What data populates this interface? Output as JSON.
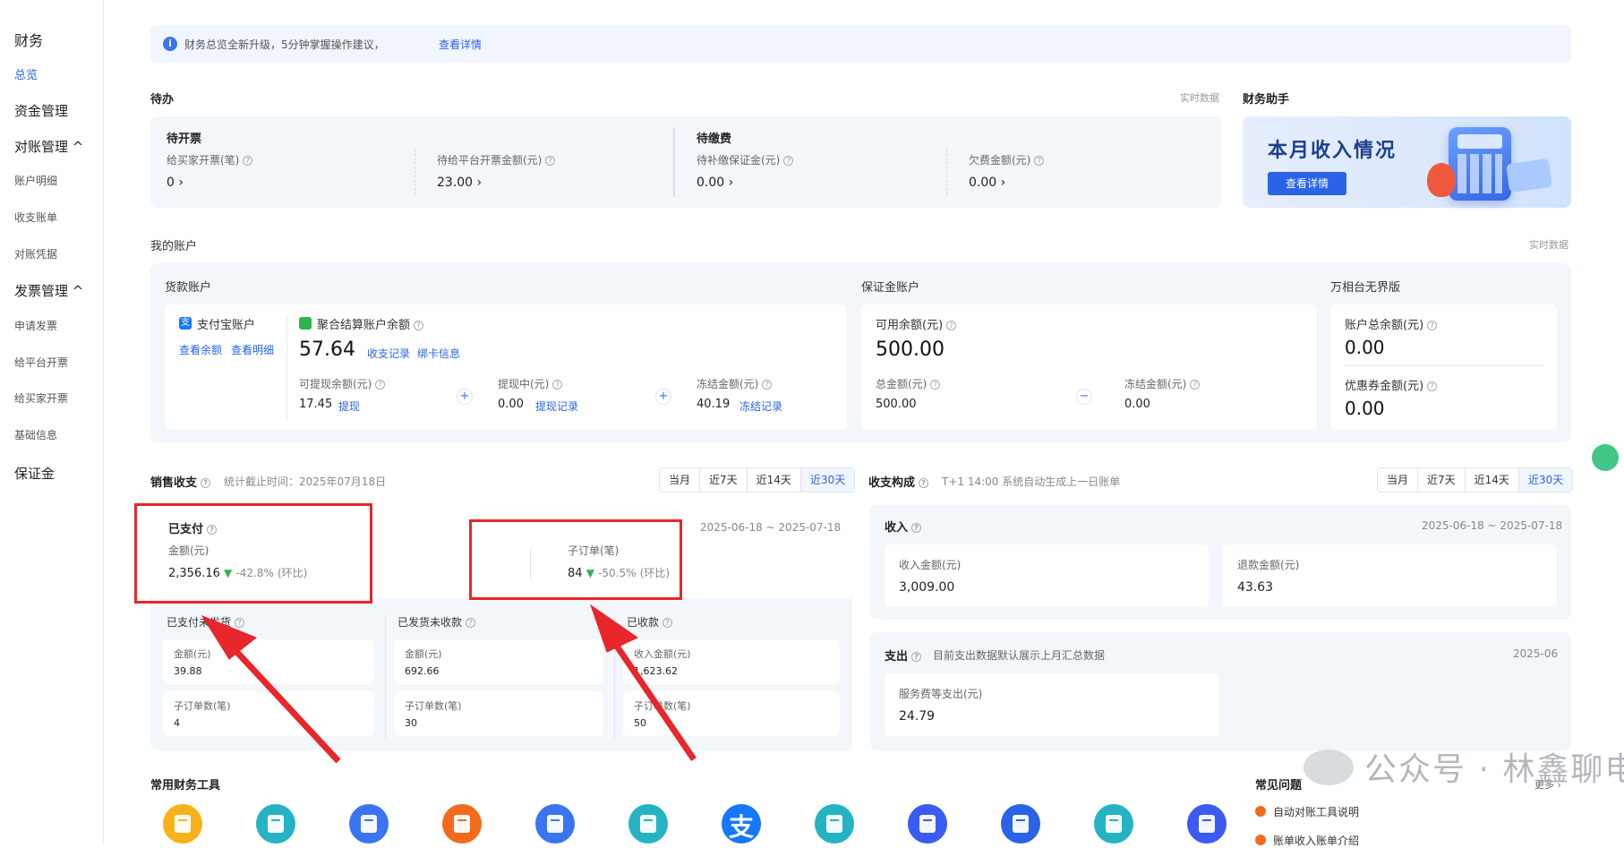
{
  "sidebar": {
    "title": "财务",
    "items": [
      {
        "label": "总览"
      },
      {
        "label": "资金管理"
      },
      {
        "label": "对账管理 ^"
      },
      {
        "label": "账户明细"
      },
      {
        "label": "收支账单"
      },
      {
        "label": "对账凭据"
      },
      {
        "label": "发票管理 ^"
      },
      {
        "label": "申请发票"
      },
      {
        "label": "给平台开票"
      },
      {
        "label": "给买家开票"
      },
      {
        "label": "基础信息"
      },
      {
        "label": "保证金"
      }
    ]
  },
  "notice": {
    "icon": "info-icon",
    "text": "财务总览全新升级，5分钟掌握操作建议，",
    "link": "查看详情"
  },
  "todo": {
    "title": "待办",
    "realtime": "实时数据",
    "invoice": {
      "title": "待开票",
      "buyer_label": "给买家开票(笔)",
      "buyer_value": "0 ›",
      "platform_label": "待给平台开票金额(元)",
      "platform_value": "23.00 ›"
    },
    "fees": {
      "title": "待缴费",
      "deposit_label": "待补缴保证金(元)",
      "deposit_value": "0.00 ›",
      "arrears_label": "欠费金额(元)",
      "arrears_value": "0.00 ›"
    }
  },
  "assistant": {
    "title": "财务助手",
    "banner_title": "本月收入情况",
    "button": "查看详情"
  },
  "accounts": {
    "title": "我的账户",
    "realtime": "实时数据",
    "goods": {
      "title": "货款账户",
      "alipay_label": "支付宝账户",
      "alipay_link1": "查看余额",
      "alipay_link2": "查看明细",
      "agg_label": "聚合结算账户余额",
      "agg_value": "57.64",
      "agg_link1": "收支记录",
      "agg_link2": "绑卡信息",
      "withdrawable_label": "可提现余额(元)",
      "withdrawable_value": "17.45",
      "withdraw_link": "提现",
      "withdrawing_label": "提现中(元)",
      "withdrawing_value": "0.00",
      "withdrawing_link": "提现记录",
      "frozen_label": "冻结金额(元)",
      "frozen_value": "40.19",
      "frozen_link": "冻结记录"
    },
    "deposit": {
      "title": "保证金账户",
      "available_label": "可用余额(元)",
      "available_value": "500.00",
      "total_label": "总金额(元)",
      "total_value": "500.00",
      "frozen_label": "冻结金额(元)",
      "frozen_value": "0.00"
    },
    "wanxiang": {
      "title": "万相台无界版",
      "balance_label": "账户总余额(元)",
      "balance_value": "0.00",
      "coupon_label": "优惠券金额(元)",
      "coupon_value": "0.00"
    }
  },
  "sales": {
    "title": "销售收支",
    "cutoff": "统计截止时间：2025年07月18日",
    "tabs": [
      "当月",
      "近7天",
      "近14天",
      "近30天"
    ],
    "range": "2025-06-18 ~ 2025-07-18",
    "paid": {
      "title": "已支付",
      "amount_label": "金额(元)",
      "amount_value": "2,356.16",
      "amount_change": "-42.8%",
      "yoy": "(环比)",
      "orders_label": "子订单(笔)",
      "orders_value": "84",
      "orders_change": "-50.5%"
    },
    "unshipped": {
      "title": "已支付未发货",
      "amount_label": "金额(元)",
      "amount_value": "39.88",
      "orders_label": "子订单数(笔)",
      "orders_value": "4"
    },
    "shipped": {
      "title": "已发货未收款",
      "amount_label": "金额(元)",
      "amount_value": "692.66",
      "orders_label": "子订单数(笔)",
      "orders_value": "30"
    },
    "received": {
      "title": "已收款",
      "amount_label": "收入金额(元)",
      "amount_value": "1,623.62",
      "orders_label": "子订单数(笔)",
      "orders_value": "50"
    }
  },
  "composition": {
    "title": "收支构成",
    "note": "T+1 14:00 系统自动生成上一日账单",
    "tabs": [
      "当月",
      "近7天",
      "近14天",
      "近30天"
    ],
    "income": {
      "title": "收入",
      "range": "2025-06-18 ~ 2025-07-18",
      "income_label": "收入金额(元)",
      "income_value": "3,009.00",
      "refund_label": "退款金额(元)",
      "refund_value": "43.63"
    },
    "expense": {
      "title": "支出",
      "note": "目前支出数据默认展示上月汇总数据",
      "month": "2025-06",
      "service_label": "服务费等支出(元)",
      "service_value": "24.79"
    }
  },
  "tools": {
    "title": "常用财务工具",
    "colors": [
      "#f5b21b",
      "#25b3c4",
      "#3b74f2",
      "#f26b1d",
      "#3b74f2",
      "#25b3c4",
      "#1677ff",
      "#25b3c4",
      "#3b5bf2",
      "#2a63e8",
      "#25b3c4",
      "#3b5bf2"
    ],
    "alipay_glyph": "支"
  },
  "faq": {
    "title": "常见问题",
    "more": "更多 ›",
    "items": [
      "自动对账工具说明",
      "账单收入账单介绍"
    ]
  },
  "watermark": "公众号 · 林鑫聊电商"
}
